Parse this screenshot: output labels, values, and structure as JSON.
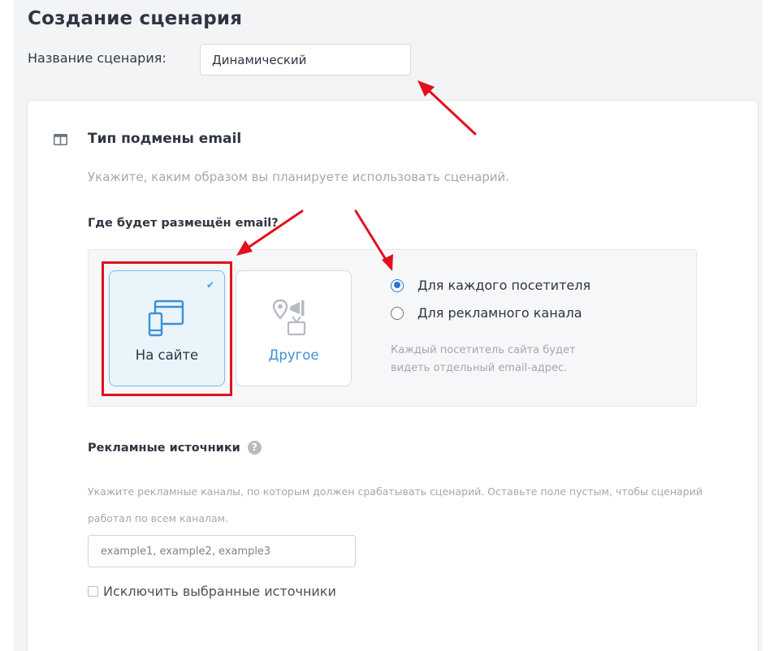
{
  "page": {
    "title": "Создание сценария"
  },
  "scenario_name": {
    "label": "Название сценария:",
    "value": "Динамический"
  },
  "email_section": {
    "icon": "columns-icon",
    "title": "Тип подмены email",
    "description": "Укажите, каким образом вы планируете использовать сценарий.",
    "question": "Где будет размещён email?",
    "placements": [
      {
        "label": "На сайте",
        "icon": "devices-icon",
        "selected": true
      },
      {
        "label": "Другое",
        "icon": "location-megaphone-tv-icon",
        "selected": false
      }
    ],
    "modes": [
      {
        "label": "Для каждого посетителя",
        "checked": true
      },
      {
        "label": "Для рекламного канала",
        "checked": false
      }
    ],
    "mode_hint": "Каждый посетитель сайта будет видеть отдельный email-адрес."
  },
  "ad_sources": {
    "title": "Рекламные источники",
    "help_icon": "question-icon",
    "description": "Укажите рекламные каналы, по которым должен срабатывать сценарий. Оставьте поле пустым, чтобы сценарий работал по всем каналам.",
    "input_placeholder": "example1, example2, example3",
    "input_value": "",
    "exclude_label": "Исключить выбранные источники",
    "exclude_checked": false
  },
  "colors": {
    "accent": "#2a74d3",
    "tile_selected_bg": "#e9f4fb",
    "annotation_red": "#e3101c"
  }
}
